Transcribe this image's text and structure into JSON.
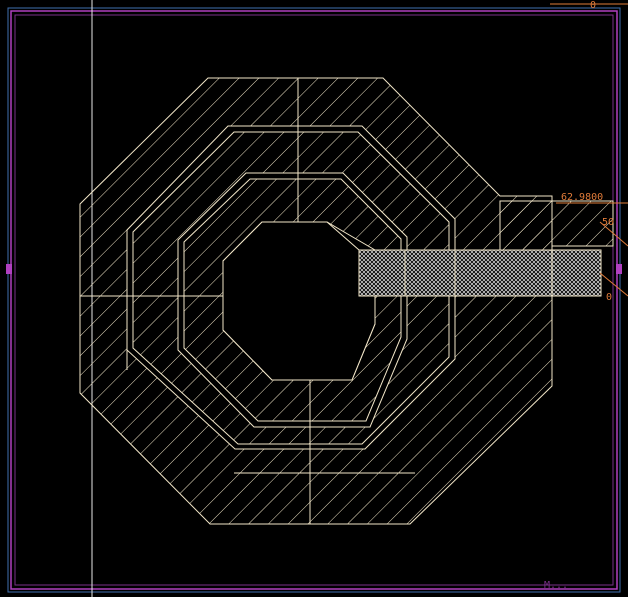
{
  "canvas": {
    "background": "#000000",
    "border_outer": "#7a2f8a",
    "border_mid": "#b040c0",
    "border_inner": "#3f70b0",
    "guide_line": "#e8e8e8",
    "inductor_stroke": "#f2e6c8",
    "hatch_color": "#f2e6c8",
    "ruler_color": "#e07b39"
  },
  "annotations": {
    "top_ruler_value": "0",
    "width_readout": "62.9800",
    "port_right_label": "50",
    "port_bottom_label": "0",
    "bottom_right_tag": "M..."
  },
  "layers": [
    "metal-outer-turn",
    "metal-middle-turn",
    "metal-inner-turn",
    "via-port-contact",
    "port-tab"
  ]
}
